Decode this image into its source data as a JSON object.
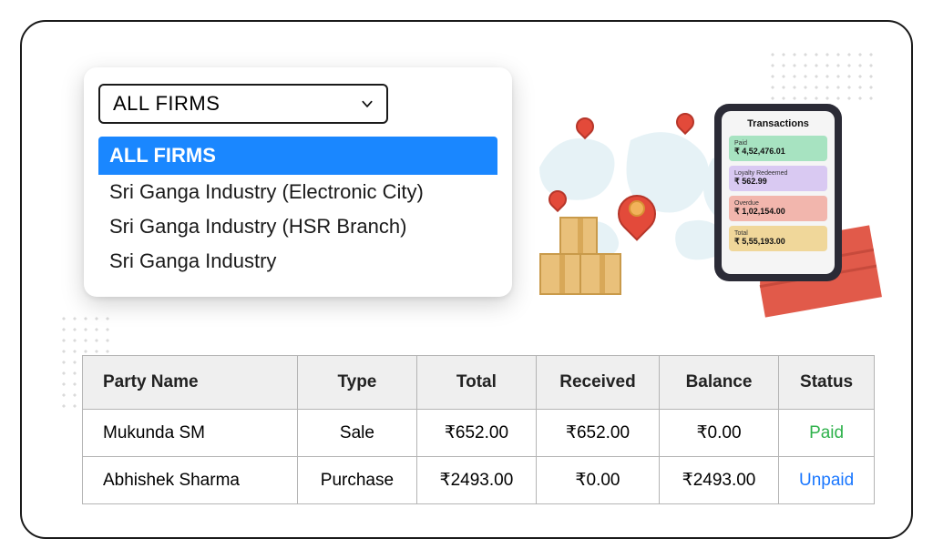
{
  "dropdown": {
    "selected": "ALL FIRMS",
    "options": [
      "ALL FIRMS",
      "Sri Ganga Industry (Electronic City)",
      "Sri Ganga Industry (HSR Branch)",
      "Sri Ganga Industry"
    ]
  },
  "phone": {
    "title": "Transactions",
    "cards": [
      {
        "label": "Paid",
        "value": "₹ 4,52,476.01"
      },
      {
        "label": "Loyalty Redeemed",
        "value": "₹ 562.99"
      },
      {
        "label": "Overdue",
        "value": "₹ 1,02,154.00"
      },
      {
        "label": "Total",
        "value": "₹ 5,55,193.00"
      }
    ]
  },
  "table": {
    "columns": [
      "Party Name",
      "Type",
      "Total",
      "Received",
      "Balance",
      "Status"
    ],
    "rows": [
      {
        "party": "Mukunda SM",
        "type": "Sale",
        "total": "₹652.00",
        "received": "₹652.00",
        "balance": "₹0.00",
        "status": "Paid",
        "status_class": "status-paid"
      },
      {
        "party": "Abhishek Sharma",
        "type": "Purchase",
        "total": "₹2493.00",
        "received": "₹0.00",
        "balance": "₹2493.00",
        "status": "Unpaid",
        "status_class": "status-unpaid"
      }
    ]
  }
}
